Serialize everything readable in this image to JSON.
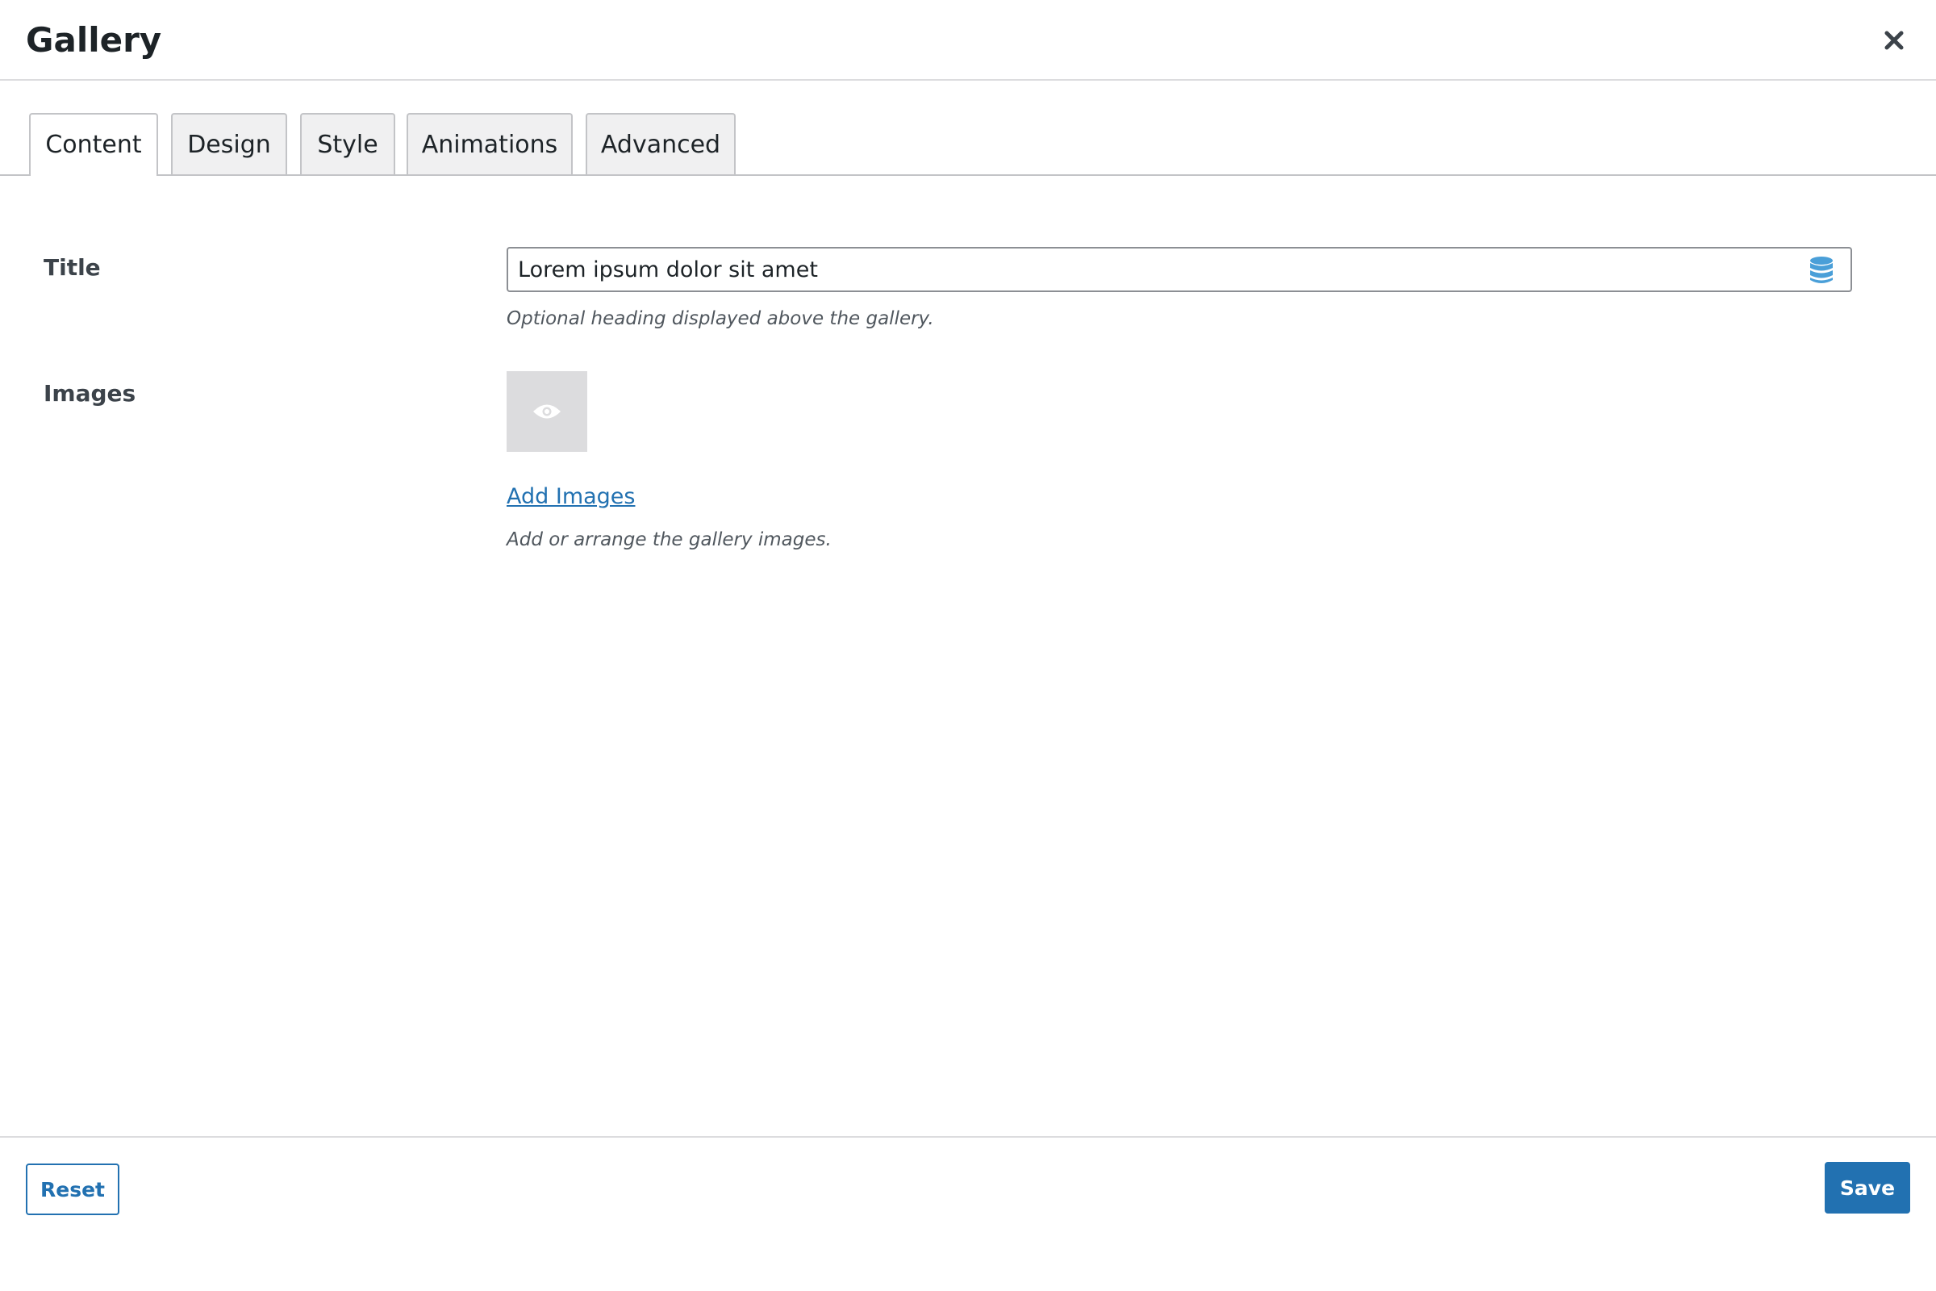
{
  "modal": {
    "title": "Gallery"
  },
  "tabs": [
    {
      "label": "Content",
      "active": true
    },
    {
      "label": "Design",
      "active": false
    },
    {
      "label": "Style",
      "active": false
    },
    {
      "label": "Animations",
      "active": false
    },
    {
      "label": "Advanced",
      "active": false
    }
  ],
  "fields": {
    "title": {
      "label": "Title",
      "value": "Lorem ipsum dolor sit amet",
      "help": "Optional heading displayed above the gallery.",
      "icon": "database-icon"
    },
    "images": {
      "label": "Images",
      "thumb_icon": "eye-icon",
      "add_link": "Add Images",
      "help": "Add or arrange the gallery images."
    }
  },
  "footer": {
    "reset_label": "Reset",
    "save_label": "Save"
  },
  "colors": {
    "accent": "#2271b1",
    "db_icon": "#4a9fd8",
    "thumb_bg": "#dcdcde"
  }
}
